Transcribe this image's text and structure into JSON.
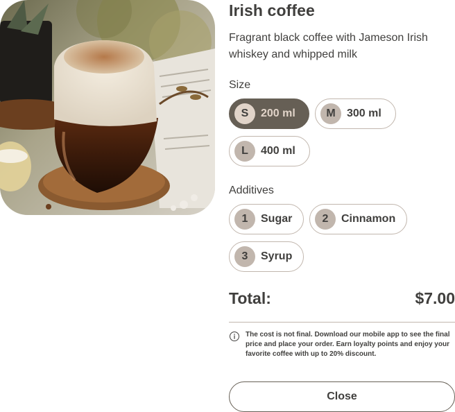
{
  "product": {
    "title": "Irish coffee",
    "description": "Fragrant black coffee with Jameson Irish whiskey and whipped milk"
  },
  "size": {
    "label": "Size",
    "options": [
      {
        "badge": "S",
        "label": "200 ml",
        "selected": true
      },
      {
        "badge": "M",
        "label": "300 ml",
        "selected": false
      },
      {
        "badge": "L",
        "label": "400 ml",
        "selected": false
      }
    ]
  },
  "additives": {
    "label": "Additives",
    "options": [
      {
        "badge": "1",
        "label": "Sugar",
        "selected": false
      },
      {
        "badge": "2",
        "label": "Cinnamon",
        "selected": false
      },
      {
        "badge": "3",
        "label": "Syrup",
        "selected": false
      }
    ]
  },
  "total": {
    "label": "Total:",
    "value": "$7.00"
  },
  "note": {
    "icon": "info-icon",
    "text": "The cost is not final. Download our mobile app to see the final price and place your order. Earn loyalty points and enjoy your favorite coffee with up to 20% discount."
  },
  "close_label": "Close",
  "colors": {
    "text_dark": "#403f3d",
    "border_light": "#c1b6ad",
    "active_bg": "#665f55",
    "active_text": "#e1d4c9"
  }
}
